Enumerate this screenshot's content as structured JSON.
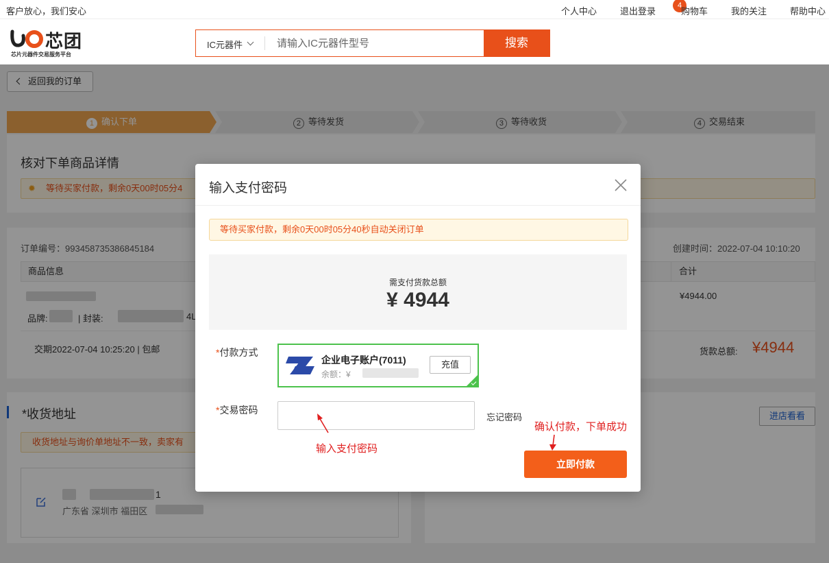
{
  "topbar": {
    "slogan": "客户放心，我们安心",
    "nav": {
      "personal_center": "个人中心",
      "logout": "退出登录",
      "cart": "购物车",
      "cart_count": "4",
      "follow": "我的关注",
      "help": "帮助中心"
    }
  },
  "header": {
    "brand": "芯团",
    "subtitle": "芯片元器件交易服务平台",
    "search": {
      "category": "IC元器件",
      "placeholder": "请输入IC元器件型号",
      "button": "搜索"
    }
  },
  "page": {
    "back_button": "返回我的订单",
    "steps": [
      {
        "num": "1",
        "label": "确认下单"
      },
      {
        "num": "2",
        "label": "等待发货"
      },
      {
        "num": "3",
        "label": "等待收货"
      },
      {
        "num": "4",
        "label": "交易结束"
      }
    ],
    "review_title": "核对下单商品详情",
    "review_warning": "等待买家付款，剩余0天00时05分4",
    "order": {
      "number_label": "订单编号：993458735386845184",
      "created_label": "创建时间：2022-07-04 10:10:20",
      "col_goods": "商品信息",
      "col_total": "合计",
      "total_value": "¥4944.00",
      "brand_label": "品牌:",
      "package_label": "|  封装:",
      "package_tail": "4L",
      "delivery": "交期2022-07-04 10:25:20 | 包邮",
      "goods_total_label": "货款总额:",
      "goods_total_value": "¥4944"
    },
    "address": {
      "title": "*收货地址",
      "warning": "收货地址与询价单地址不一致，卖家有",
      "suffix": "1",
      "region": "广东省 深圳市 福田区"
    },
    "shop_button": "进店看看"
  },
  "modal": {
    "title": "输入支付密码",
    "warning": "等待买家付款，剩余0天00时05分40秒自动关闭订单",
    "amount_label": "需支付货款总额",
    "amount_value": "¥ 4944",
    "pay_method_label": "付款方式",
    "account_name": "企业电子账户(7011)",
    "balance_label": "余额：¥",
    "recharge": "充值",
    "password_label": "交易密码",
    "forgot_password": "忘记密码",
    "pay_button": "立即付款"
  },
  "annotations": {
    "password_hint": "输入支付密码",
    "pay_hint": "确认付款，下单成功"
  },
  "colors": {
    "accent": "#e8501a",
    "step_active": "#f0a650",
    "selected_border": "#4cc24c",
    "annotation": "#e02020"
  }
}
